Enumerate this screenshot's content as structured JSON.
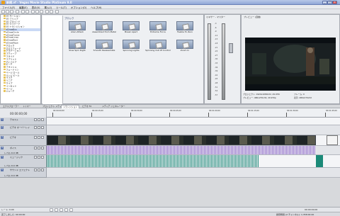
{
  "window": {
    "title": "新規.vf - Vegas Movie Studio Platinum 9.0"
  },
  "menu": [
    "ファイル(F)",
    "編集(E)",
    "表示(V)",
    "挿入(I)",
    "ツール(T)",
    "オプション(O)",
    "ヘルプ(H)"
  ],
  "explorer": {
    "items": [
      "3D モーション",
      "3D フリップ",
      "3D ブラインド",
      "3D カスケード",
      "3D トランジション",
      "eDrawBox",
      "eDrawCircle",
      "eDrawFrame",
      "eDrawLines",
      "eDrawRect",
      "eDrawWipe",
      "クロック",
      "クロスフェード",
      "グラデーション",
      "スウィープ",
      "スライド",
      "スプリット",
      "ディゾルブ",
      "ピーク",
      "フラッシュ",
      "フェードイン",
      "ページ ロール",
      "ページ ピール",
      "マスク",
      "リニア",
      "ワイプ",
      "インセット",
      "ページ",
      "ジューク"
    ],
    "selected_index": 5
  },
  "effects": {
    "heading": "ブロック",
    "items": [
      {
        "label": "Alien Attack"
      },
      {
        "label": "Assembled from Metal"
      },
      {
        "label": "Break Apart"
      },
      {
        "label": "Extreme Force"
      },
      {
        "label": "Feeble To Zero"
      },
      {
        "label": "Slow Spin Right"
      },
      {
        "label": "Smooth Reassemble"
      },
      {
        "label": "Spinning Lights"
      },
      {
        "label": "Spinning Out Of Control"
      },
      {
        "label": "Zoom In"
      }
    ]
  },
  "meters": {
    "title": "ミキサー - マスター",
    "scale": [
      "-3",
      "-6",
      "-9",
      "-12",
      "-15",
      "-18",
      "-21",
      "-24",
      "-27",
      "-30",
      "-33",
      "-36",
      "-39",
      "-42",
      "-45",
      "-48",
      "-51",
      "-54",
      "-57"
    ]
  },
  "preview": {
    "mode": "プレビュー (自動)",
    "project_label": "プロジェクト:",
    "project_value": "1920x1080x32, 29.970i",
    "preview_label": "プレビュー:",
    "preview_value": "480x270x32, 29.970p",
    "frame_label": "フレーム:",
    "frame_value": "0",
    "display_label": "表示:",
    "display_value": "480x270x32"
  },
  "tabs": [
    "エクスプローラー",
    "トリマー",
    "プロジェクト メディア",
    "トランジション",
    "ビデオ FX",
    "メディア ジェネレーター"
  ],
  "selected_tab": 3,
  "timeline": {
    "timecode": "00:00:00;00",
    "ruler": [
      "00:00:00;00",
      "00:00:15;00",
      "00:00:30;00",
      "00:00:45;00",
      "00:01:00;00",
      "00:01:15;00",
      "00:01:30;00",
      "00:01:45;00"
    ],
    "tracks": [
      {
        "num": "1",
        "name": "テキスト"
      },
      {
        "num": "2",
        "name": "ビデオ オーバーレイ"
      },
      {
        "num": "3",
        "name": "ビデオ"
      },
      {
        "num": "4",
        "name": "ボイス"
      },
      {
        "num": "5",
        "name": "ミュージック"
      },
      {
        "num": "6",
        "name": "サウンド エフェクト"
      }
    ],
    "track_info": {
      "level_label": "レベル:",
      "level_value": "0.0 dB",
      "pan_label": "パン:",
      "pan_value": "センター"
    }
  },
  "transport": {
    "rate_label": "レート:",
    "rate_value": "0.00",
    "time_value": "00:00:00;00"
  },
  "status": {
    "left": "完了しました: 00:00:00",
    "right": "録音時間 (2 チャンネル): 1,358:00:00"
  },
  "colors": {
    "audio": "#8a63c9",
    "music": "#1b8a78",
    "accent": "#6279ad"
  }
}
